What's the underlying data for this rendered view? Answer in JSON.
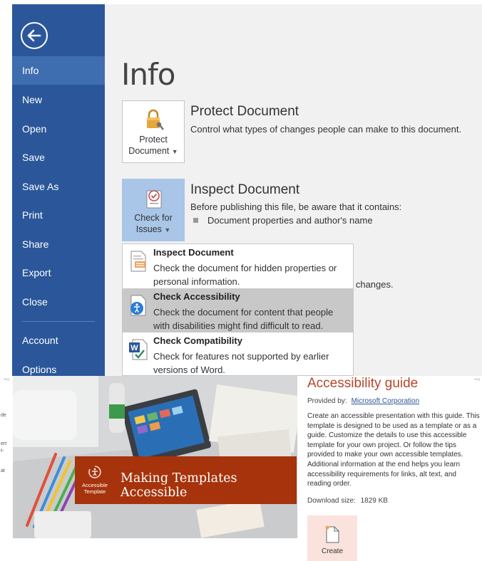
{
  "backstage": {
    "nav": [
      {
        "label": "Info"
      },
      {
        "label": "New"
      },
      {
        "label": "Open"
      },
      {
        "label": "Save"
      },
      {
        "label": "Save As"
      },
      {
        "label": "Print"
      },
      {
        "label": "Share"
      },
      {
        "label": "Export"
      },
      {
        "label": "Close"
      },
      {
        "label": "Account"
      },
      {
        "label": "Options"
      }
    ],
    "page_title": "Info",
    "protect": {
      "btn_line1": "Protect",
      "btn_line2": "Document",
      "title": "Protect Document",
      "desc": "Control what types of changes people can make to this document."
    },
    "inspect": {
      "btn_line1": "Check for",
      "btn_line2": "Issues",
      "title": "Inspect Document",
      "desc": "Before publishing this file, be aware that it contains:",
      "bullet": "Document properties and author's name",
      "changes_fragment": "d changes."
    },
    "menu": [
      {
        "title": "Inspect Document",
        "desc": "Check the document for hidden properties or personal information."
      },
      {
        "title": "Check Accessibility",
        "desc": "Check the document for content that people with disabilities might find difficult to read."
      },
      {
        "title": "Check Compatibility",
        "desc": "Check for features not supported by earlier versions of Word."
      }
    ]
  },
  "template": {
    "banner_icon_label": "Accessible Template",
    "banner_text": "Making Templates Accessible",
    "title": "Accessibility guide",
    "provided_by_label": "Provided by:",
    "provider": "Microsoft Corporation",
    "description": "Create an accessible presentation with this guide. This template is designed to be used as a template or as a guide. Customize the details to use this accessible template for your own project. Or follow the tips provided to make your own accessible templates. Additional information at the end helps you learn accessibility requirements for links, alt text, and reading order.",
    "download_size_label": "Download size:",
    "download_size": "1829 KB",
    "create_label": "Create",
    "left_fragments": [
      "de",
      "ert",
      "t-",
      "at"
    ]
  },
  "colors": {
    "nav_bg": "#2b579a",
    "nav_active": "#3e6db0",
    "button_hot": "#a9c5e8",
    "banner": "#a6330b",
    "guide_title": "#b7472a",
    "create_bg": "#fbe3dd"
  }
}
